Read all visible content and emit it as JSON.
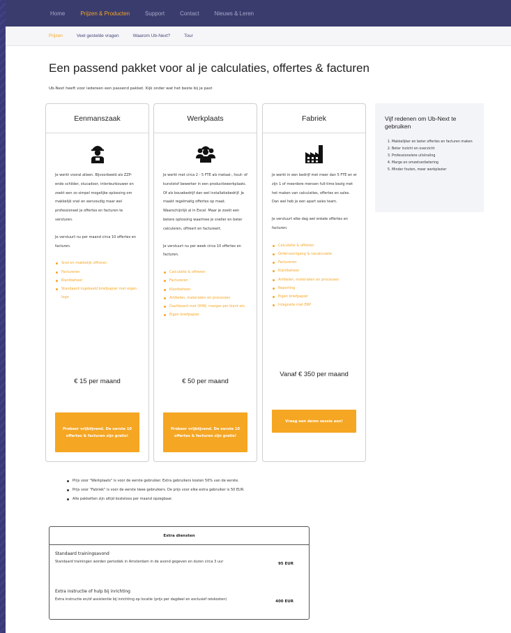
{
  "topnav": {
    "items": [
      {
        "label": "Home"
      },
      {
        "label": "Prijzen & Producten",
        "active": true
      },
      {
        "label": "Support"
      },
      {
        "label": "Contact"
      },
      {
        "label": "Nieuws & Leren"
      }
    ]
  },
  "subnav": {
    "items": [
      {
        "label": "Prijzen",
        "active": true
      },
      {
        "label": "Veel gestelde vragen"
      },
      {
        "label": "Waarom Ub-Next?"
      },
      {
        "label": "Tour"
      }
    ]
  },
  "page": {
    "title": "Een passend pakket voor al je calculaties, offertes & facturen",
    "intro": "Ub-Next heeft voor iedereen een passend pakket. Kijk onder wat het beste bij je past"
  },
  "plans": [
    {
      "name": "Eenmanszaak",
      "icon": "worker-icon",
      "desc": [
        "Je werkt vooral alleen. Bijvoorbeeld als ZZP-ende schilder, stucadoor, interieurbouwer en zoekt een zo simpel mogelijke oplossing om makkelijk snel en eenvoudig maar wel professioneel je offertes en facturen te versturen.",
        "Je verstuurt nu per maand circa 10 offertes en facturen."
      ],
      "features": [
        "Snel en makkelijk offreren",
        "Factureren",
        "Klantbeheer",
        "Standaard ingebeeld briefpapier met eigen logo"
      ],
      "price": "€ 15 per maand",
      "cta": "Probeer vrijblijvend. De eerste 10 offertes & facturen zijn gratis!"
    },
    {
      "name": "Werkplaats",
      "icon": "team-icon",
      "desc": [
        "Je werkt met circa 2 - 5 FTE als metaal-, hout- of kunststof bewerker in een productiewerkplaats. Of als bouwbedrijf dan wel installatiebedrijf. Je maakt regelmatig offertes op maat. Waarschijnlijk al in Excel. Maar je zoekt een betere oplossing waarmee je sneller en beter calculeren, offreert en factureert.",
        "Je verstuurt nu per week circa 10 offertes en facturen."
      ],
      "features": [
        "Calculatie & offreren",
        "Factureren",
        "Klantbeheer",
        "Artikelen, materialen en processen",
        "Dashboard met OHW, marges per klant etc.",
        "Eigen briefpapier"
      ],
      "price": "€ 50 per maand",
      "cta": "Probeer vrijblijvend. De eerste 10 offertes & facturen zijn gratis!"
    },
    {
      "name": "Fabriek",
      "icon": "factory-icon",
      "desc": [
        "Je werkt in een bedrijf met meer dan 5 FTE en er zijn 1 of meerdere mensen full-time bezig met het maken van calculaties, offertes en sales. Dan wel heb je een apart sales team.",
        "Je verstuurt elke dag wel enkele offertes en facturen."
      ],
      "features": [
        "Calculatie & offreren",
        "Ordervoortgang & nacalculatie",
        "Factureren",
        "Klantbeheer",
        "Artikelen, materialen en processen",
        "Reporting",
        "Eigen briefpapier",
        "Integratie met ERP"
      ],
      "price": "Vanaf € 350 per maand",
      "cta": "Vraag een demo sessie aan!"
    }
  ],
  "aside": {
    "title": "Vijf redenen om Ub-Next te gebruiken",
    "items": [
      "Makkelijker en beter offertes en facturen maken",
      "Beter inzicht en overzicht",
      "Professionelere uitstraling",
      "Marge en omzetverbetering",
      "Minder fouten, meer werkplezier"
    ]
  },
  "notes": [
    "Prijs voor \"Werkplaats\" is voor de eerste gebruiker. Extra gebruikers kosten 50% van de eerste.",
    "Prijs voor \"Fabriek\" is voor de eerste twee gebruikers. De prijs voor elke extra gebruiker is 50 EUR.",
    "Alle pakketten zijn altijd kosteloos per maand opzegbaar."
  ],
  "extras": {
    "title": "Extra diensten",
    "rows": [
      {
        "title": "Standaard trainingsavond",
        "desc": "Standaard trainingen worden periodiek in Amsterdam in de avond gegeven en duren circa 3 uur",
        "price": "95 EUR"
      },
      {
        "title": "Extra instructie of hulp bij inrichting",
        "desc": "Extra instructie en/of assistentie bij inrichting op locatie (prijs per dagdeel en exclusief reiskosten)",
        "price": "400 EUR"
      }
    ]
  },
  "colors": {
    "accent": "#f5a623",
    "nav": "#3b3c6e",
    "background": "#3a3a7a"
  }
}
